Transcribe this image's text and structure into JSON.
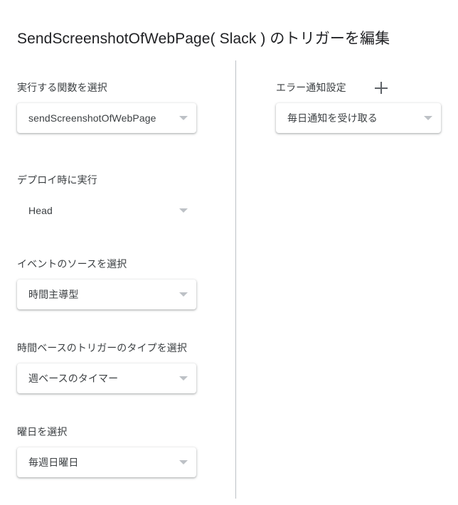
{
  "page": {
    "title": "SendScreenshotOfWebPage( Slack ) のトリガーを編集"
  },
  "left_column": {
    "fields": [
      {
        "label": "実行する関数を選択",
        "value": "sendScreenshotOfWebPage",
        "style": "card",
        "caret": "chevron-down-icon"
      },
      {
        "label": "デプロイ時に実行",
        "value": "Head",
        "style": "flat",
        "caret": "chevron-down-icon"
      },
      {
        "label": "イベントのソースを選択",
        "value": "時間主導型",
        "style": "card",
        "caret": "chevron-down-icon"
      },
      {
        "label": "時間ベースのトリガーのタイプを選択",
        "value": "週ベースのタイマー",
        "style": "card",
        "caret": "chevron-down-icon"
      },
      {
        "label": "曜日を選択",
        "value": "毎週日曜日",
        "style": "card",
        "caret": "chevron-down-icon"
      }
    ]
  },
  "right_column": {
    "label": "エラー通知設定",
    "add_icon": "plus-icon",
    "value": "毎日通知を受け取る",
    "caret": "chevron-down-icon"
  },
  "colors": {
    "background": "#ffffff",
    "title_text": "#202124",
    "label_text": "#3c4043",
    "value_text": "#3c4043",
    "divider": "#bdc1c6",
    "caret": "#bdc1c6",
    "plus": "#5f6368"
  }
}
